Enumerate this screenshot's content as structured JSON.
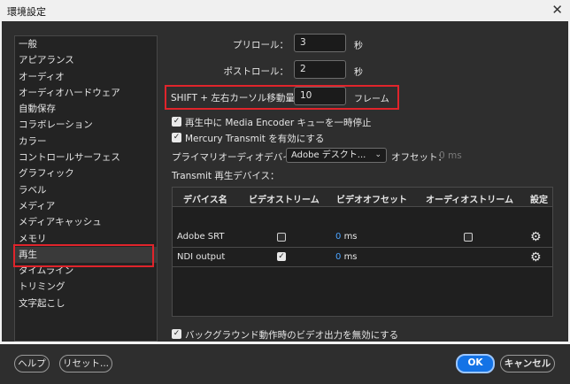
{
  "window": {
    "title": "環境設定",
    "close_glyph": "✕"
  },
  "sidebar": {
    "items": [
      {
        "label": "一般"
      },
      {
        "label": "アピアランス"
      },
      {
        "label": "オーディオ"
      },
      {
        "label": "オーディオハードウェア"
      },
      {
        "label": "自動保存"
      },
      {
        "label": "コラボレーション"
      },
      {
        "label": "カラー"
      },
      {
        "label": "コントロールサーフェス"
      },
      {
        "label": "グラフィック"
      },
      {
        "label": "ラベル"
      },
      {
        "label": "メディア"
      },
      {
        "label": "メディアキャッシュ"
      },
      {
        "label": "メモリ"
      },
      {
        "label": "再生"
      },
      {
        "label": "タイムライン"
      },
      {
        "label": "トリミング"
      },
      {
        "label": "文字起こし"
      }
    ],
    "selected": "再生"
  },
  "playback": {
    "preroll_label": "プリロール：",
    "preroll_value": "3",
    "preroll_unit": "秒",
    "postroll_label": "ポストロール：",
    "postroll_value": "2",
    "postroll_unit": "秒",
    "shift_label": "SHIFT + 左右カーソル移動量：",
    "shift_value": "10",
    "shift_unit": "フレーム",
    "media_encoder_label": "再生中に Media Encoder キューを一時停止",
    "media_encoder_checked": true,
    "mercury_label": "Mercury Transmit を有効にする",
    "mercury_checked": true,
    "primary_audio_label": "プライマリオーディオデバイス：",
    "primary_audio_value": "Adobe デスクト...",
    "offset_label": "オフセット：",
    "offset_value": "0 ms",
    "transmit_label": "Transmit 再生デバイス：",
    "background_label": "バックグラウンド動作時のビデオ出力を無効にする",
    "background_checked": true
  },
  "devices_table": {
    "headers": [
      "デバイス名",
      "ビデオストリーム",
      "ビデオオフセット",
      "オーディオストリーム",
      "設定"
    ],
    "rows": [
      {
        "name": "Adobe SRT",
        "video_stream": false,
        "offset_num": "0",
        "offset_unit": "ms",
        "audio_stream": false,
        "settings_icon": "gear-icon"
      },
      {
        "name": "NDI output",
        "video_stream": true,
        "offset_num": "0",
        "offset_unit": "ms",
        "audio_stream": null,
        "settings_icon": "gear-icon"
      }
    ]
  },
  "footer": {
    "help_label": "ヘルプ",
    "reset_label": "リセット...",
    "ok_label": "OK",
    "cancel_label": "キャンセル"
  },
  "colors": {
    "accent": "#1473e6",
    "highlight": "#e0242b",
    "offset_value": "#4aa3ff",
    "dialog_bg": "#2e2e2e"
  }
}
